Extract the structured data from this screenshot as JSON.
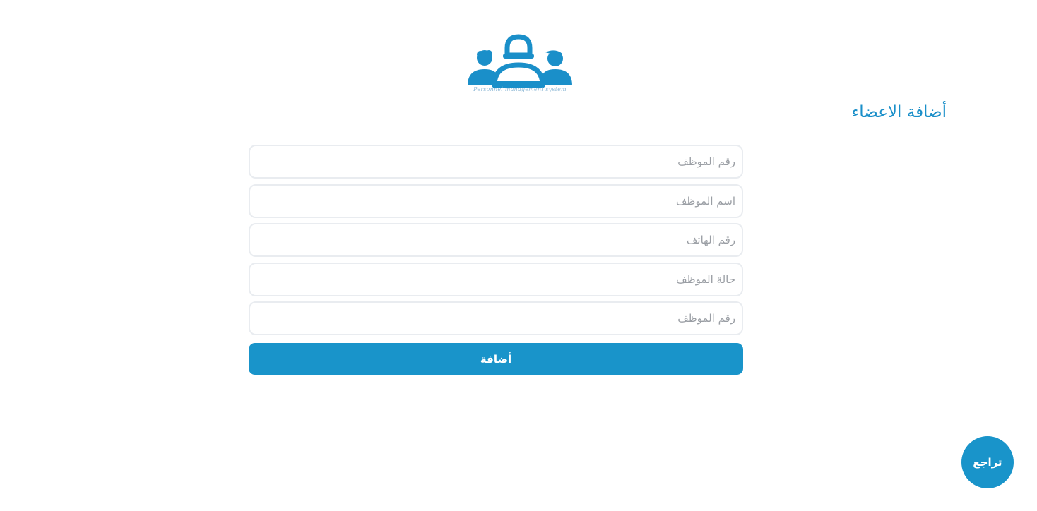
{
  "logo": {
    "icon": "people-group-icon",
    "tagline": "Personnel management system",
    "color": "#1a8fc9"
  },
  "header": {
    "title": "أضافة الاعضاء"
  },
  "form": {
    "fields": [
      {
        "placeholder": "رقم الموظف",
        "value": ""
      },
      {
        "placeholder": "اسم الموظف",
        "value": ""
      },
      {
        "placeholder": "رقم الهاتف",
        "value": ""
      },
      {
        "placeholder": "حالة الموظف",
        "value": ""
      },
      {
        "placeholder": "رقم الموظف",
        "value": ""
      }
    ],
    "submit_label": "أضافة"
  },
  "back_button": {
    "label": "تراجع"
  },
  "colors": {
    "accent": "#1994ca",
    "input_border": "#e9ecf0",
    "placeholder": "#9a9ea4"
  }
}
